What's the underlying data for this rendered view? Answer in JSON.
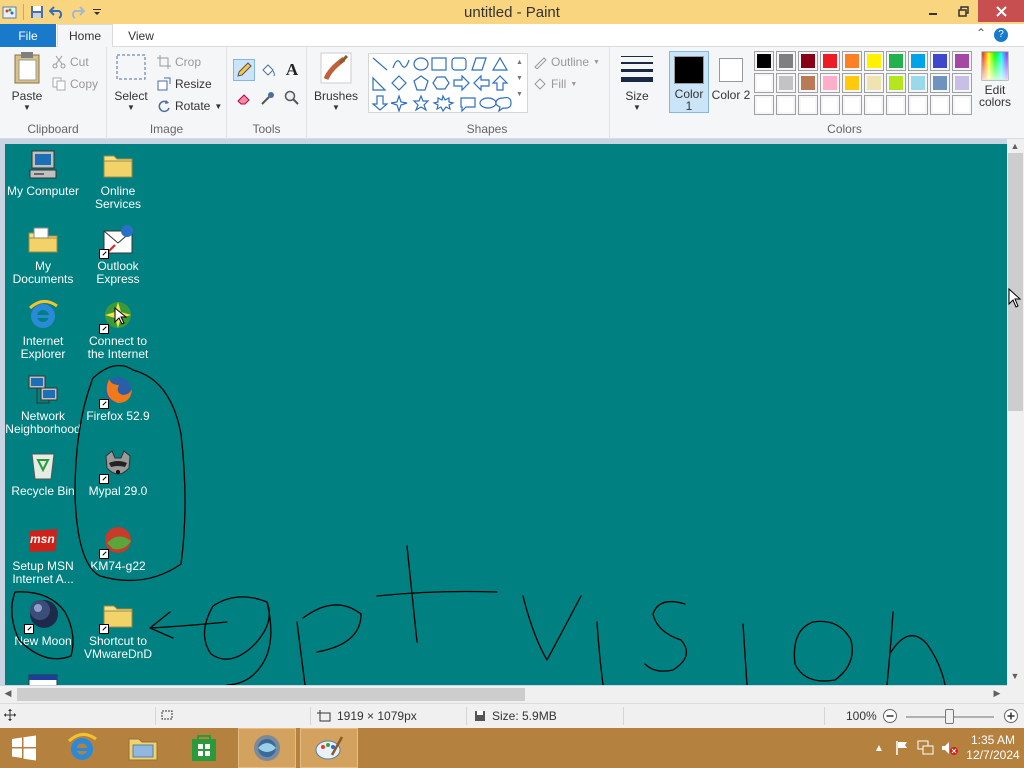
{
  "window": {
    "title": "untitled - Paint"
  },
  "ribbon": {
    "tabs": {
      "file": "File",
      "home": "Home",
      "view": "View"
    },
    "clipboard": {
      "paste": "Paste",
      "cut": "Cut",
      "copy": "Copy",
      "label": "Clipboard"
    },
    "image": {
      "select": "Select",
      "crop": "Crop",
      "resize": "Resize",
      "rotate": "Rotate",
      "label": "Image"
    },
    "tools": {
      "label": "Tools"
    },
    "brushes": {
      "label": "Brushes"
    },
    "shapes": {
      "outline": "Outline",
      "fill": "Fill",
      "label": "Shapes"
    },
    "size": {
      "label": "Size"
    },
    "colors": {
      "color1": "Color 1",
      "color2": "Color 2",
      "edit": "Edit colors",
      "label": "Colors",
      "color1_value": "#000000",
      "color2_value": "#ffffff",
      "palette": [
        [
          "#000000",
          "#7f7f7f",
          "#880015",
          "#ed1c24",
          "#ff7f27",
          "#fff200",
          "#22b14c",
          "#00a2e8",
          "#3f48cc",
          "#a349a4"
        ],
        [
          "#ffffff",
          "#c3c3c3",
          "#b97a57",
          "#ffaec9",
          "#ffc90e",
          "#efe4b0",
          "#b5e61d",
          "#99d9ea",
          "#7092be",
          "#c8bfe7"
        ],
        [
          "#ffffff",
          "#ffffff",
          "#ffffff",
          "#ffffff",
          "#ffffff",
          "#ffffff",
          "#ffffff",
          "#ffffff",
          "#ffffff",
          "#ffffff"
        ]
      ]
    }
  },
  "canvas": {
    "background": "#008080",
    "icons": [
      {
        "label": "My Computer",
        "icon": "computer-icon"
      },
      {
        "label": "Online Services",
        "icon": "folder-icon"
      },
      {
        "label": "My Documents",
        "icon": "documents-folder-icon"
      },
      {
        "label": "Outlook Express",
        "icon": "outlook-icon"
      },
      {
        "label": "Internet Explorer",
        "icon": "ie-icon"
      },
      {
        "label": "Connect to the Internet",
        "icon": "connect-icon"
      },
      {
        "label": "Network Neighborhood",
        "icon": "network-icon"
      },
      {
        "label": "Firefox 52.9",
        "icon": "firefox-icon"
      },
      {
        "label": "Recycle Bin",
        "icon": "recycle-bin-icon"
      },
      {
        "label": "Mypal 29.0",
        "icon": "mypal-icon"
      },
      {
        "label": "Setup MSN Internet A...",
        "icon": "msn-icon"
      },
      {
        "label": "KM74-g22",
        "icon": "km-icon"
      },
      {
        "label": "New Moon",
        "icon": "new-moon-icon"
      },
      {
        "label": "Shortcut to VMwareDnD",
        "icon": "folder-icon"
      }
    ],
    "msn_badge": "msn"
  },
  "status": {
    "dimensions": "1919 × 1079px",
    "size": "Size: 5.9MB",
    "zoom": "100%"
  },
  "taskbar": {
    "time": "1:35 AM",
    "date": "12/7/2024"
  }
}
